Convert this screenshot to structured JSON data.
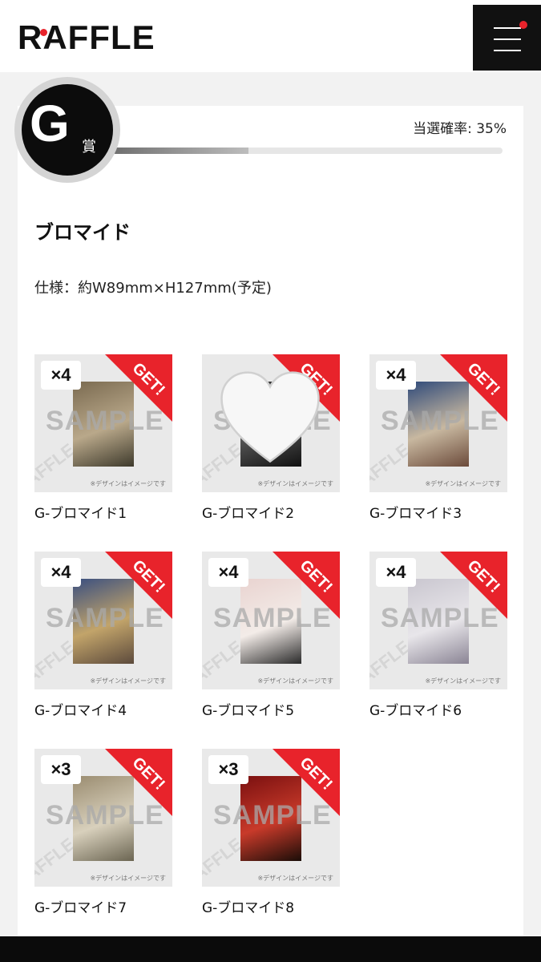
{
  "header": {
    "logo": "RAFFLE",
    "menu_icon": "hamburger-icon",
    "notification_color": "#e8232b"
  },
  "prize": {
    "badge_letter": "G",
    "badge_suffix": "賞",
    "rate_text": "当選確率: 35%",
    "rate_value": 0.35,
    "title": "ブロマイド",
    "spec": "仕様：約W89mm×H127mm(予定)"
  },
  "thumb_common": {
    "watermark": "SAMPLE",
    "ribbon_label": "GET!",
    "note": "※デザインはイメージです",
    "ribbon_color": "#e8232b"
  },
  "items": [
    {
      "name": "G-ブロマイド1",
      "qty": "×4",
      "covered": false
    },
    {
      "name": "G-ブロマイド2",
      "qty": "",
      "covered": true
    },
    {
      "name": "G-ブロマイド3",
      "qty": "×4",
      "covered": false
    },
    {
      "name": "G-ブロマイド4",
      "qty": "×4",
      "covered": false
    },
    {
      "name": "G-ブロマイド5",
      "qty": "×4",
      "covered": false
    },
    {
      "name": "G-ブロマイド6",
      "qty": "×4",
      "covered": false
    },
    {
      "name": "G-ブロマイド7",
      "qty": "×3",
      "covered": false
    },
    {
      "name": "G-ブロマイド8",
      "qty": "×3",
      "covered": false
    }
  ]
}
